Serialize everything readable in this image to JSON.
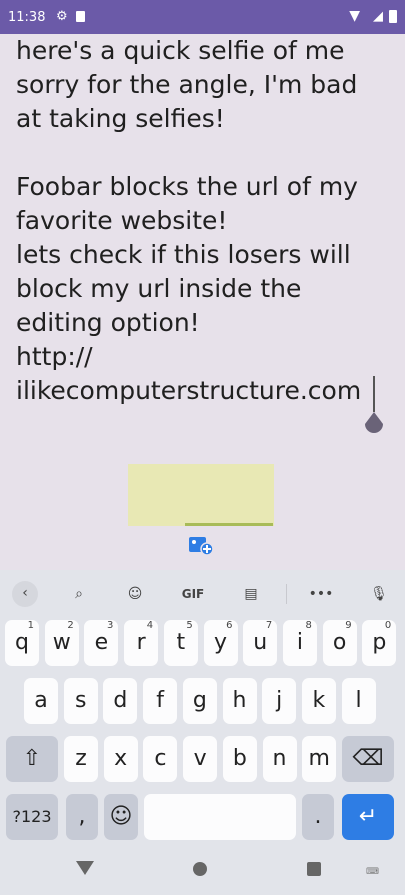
{
  "status_bar": {
    "time": "11:38",
    "icons": [
      "gear-icon",
      "sd-card-icon",
      "wifi-icon",
      "signal-icon",
      "battery-icon"
    ]
  },
  "editor": {
    "partial_top_line": "here's a quick selfie of me",
    "text": "here's a quick selfie of me\nsorry for the angle, I'm bad\nat taking selfies!\n\nFoobar blocks the url of my\nfavorite website!\nlets check if this losers will\nblock my url inside the\nediting option!\nhttp://\nilikecomputerstructure.com"
  },
  "keyboard": {
    "toolbar": [
      "back-icon",
      "search-icon",
      "sticker-icon",
      "GIF",
      "clipboard-icon",
      "more-icon",
      "mic-icon"
    ],
    "gif_label": "GIF",
    "more_label": "•••",
    "row1": [
      {
        "k": "q",
        "h": "1"
      },
      {
        "k": "w",
        "h": "2"
      },
      {
        "k": "e",
        "h": "3"
      },
      {
        "k": "r",
        "h": "4"
      },
      {
        "k": "t",
        "h": "5"
      },
      {
        "k": "y",
        "h": "6"
      },
      {
        "k": "u",
        "h": "7"
      },
      {
        "k": "i",
        "h": "8"
      },
      {
        "k": "o",
        "h": "9"
      },
      {
        "k": "p",
        "h": "0"
      }
    ],
    "row2": [
      "a",
      "s",
      "d",
      "f",
      "g",
      "h",
      "j",
      "k",
      "l"
    ],
    "row3": [
      "z",
      "x",
      "c",
      "v",
      "b",
      "n",
      "m"
    ],
    "num_label": "?123",
    "comma": ",",
    "period": ".",
    "emoji": "☺",
    "enter": "↵",
    "shift": "⇧",
    "backspace": "⌫"
  },
  "navbar": {
    "keyboard_label": "⌨"
  },
  "colors": {
    "status_bar": "#6b5aa8",
    "enter_key": "#2e7de4",
    "preview": "#e8e8b4"
  }
}
